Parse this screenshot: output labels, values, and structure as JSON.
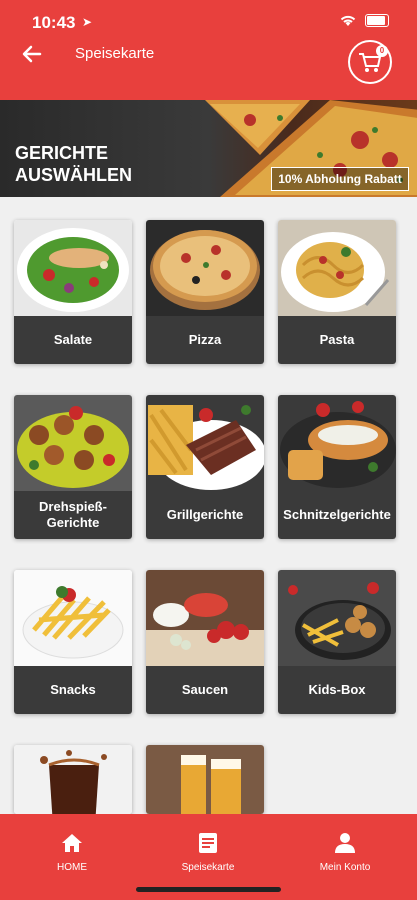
{
  "status": {
    "time": "10:43"
  },
  "header": {
    "title": "Speisekarte",
    "cart_count": "0"
  },
  "banner": {
    "title_line1": "GERICHTE",
    "title_line2": "AUSWÄHLEN",
    "discount": "10% Abholung Rabatt"
  },
  "categories": [
    {
      "label": "Salate"
    },
    {
      "label": "Pizza"
    },
    {
      "label": "Pasta"
    },
    {
      "label": "Drehspieß-\nGerichte"
    },
    {
      "label": "Grillgerichte"
    },
    {
      "label": "Schnitzelgerichte"
    },
    {
      "label": "Snacks"
    },
    {
      "label": "Saucen"
    },
    {
      "label": "Kids-Box"
    }
  ],
  "nav": [
    {
      "label": "HOME",
      "icon": "home-icon"
    },
    {
      "label": "Speisekarte",
      "icon": "menu-icon"
    },
    {
      "label": "Mein Konto",
      "icon": "user-icon"
    }
  ],
  "colors": {
    "primary": "#e8403d",
    "card_label_bg": "#3a3a3a"
  }
}
